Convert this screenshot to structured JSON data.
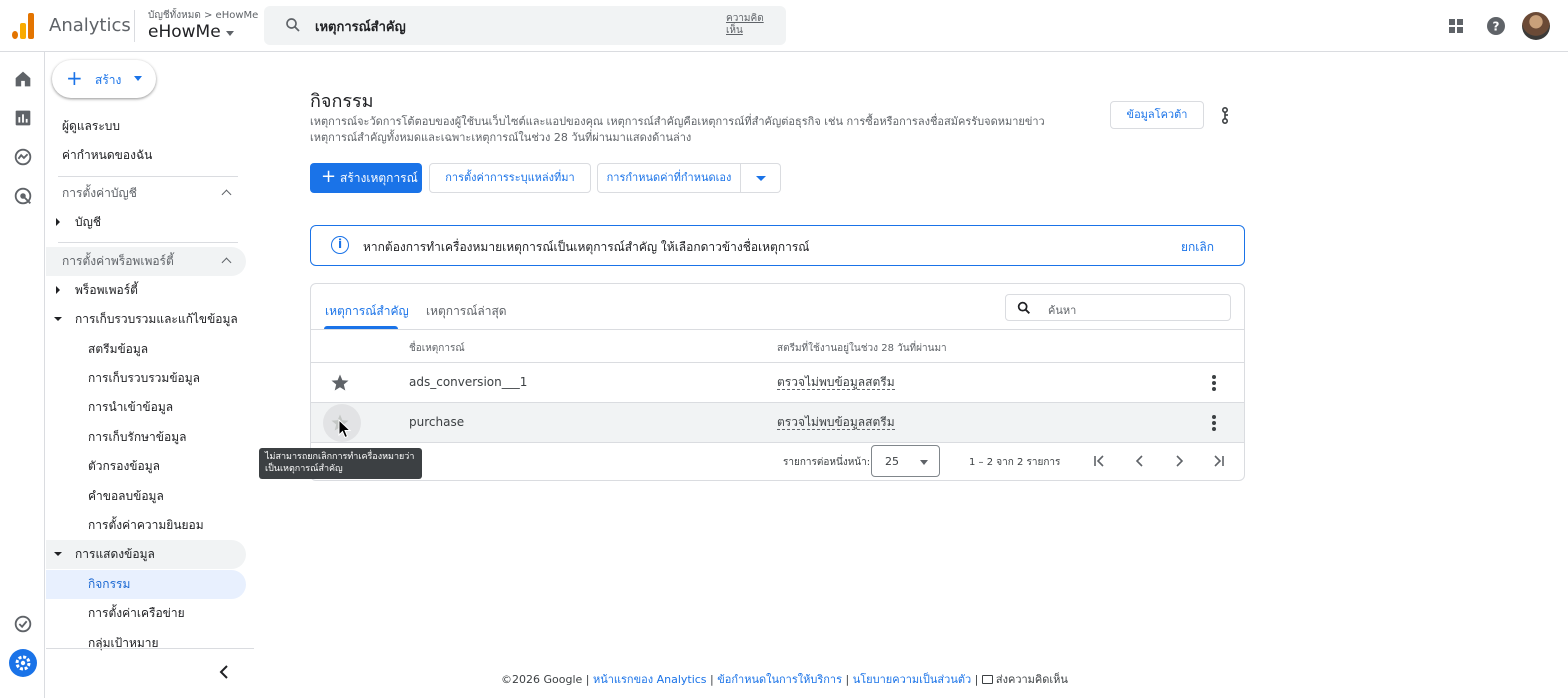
{
  "header": {
    "app_name": "Analytics",
    "account_crumb": "บัญชีทั้งหมด > eHowMe",
    "account_name": "eHowMe",
    "search_text": "เหตุการณ์สำคัญ",
    "feedback": "ความคิดเห็น"
  },
  "sidebar": {
    "create_label": "สร้าง",
    "items": [
      {
        "label": "ผู้ดูแลระบบ"
      },
      {
        "label": "ค่ากำหนดของฉัน"
      },
      {
        "label": "การตั้งค่าบัญชี"
      },
      {
        "label": "บัญชี"
      },
      {
        "label": "การตั้งค่าพร็อพเพอร์ตี้"
      },
      {
        "label": "พร็อพเพอร์ตี้"
      },
      {
        "label": "การเก็บรวบรวมและแก้ไขข้อมูล"
      },
      {
        "label": "สตรีมข้อมูล"
      },
      {
        "label": "การเก็บรวบรวมข้อมูล"
      },
      {
        "label": "การนำเข้าข้อมูล"
      },
      {
        "label": "การเก็บรักษาข้อมูล"
      },
      {
        "label": "ตัวกรองข้อมูล"
      },
      {
        "label": "คำขอลบข้อมูล"
      },
      {
        "label": "การตั้งค่าความยินยอม"
      },
      {
        "label": "การแสดงข้อมูล"
      },
      {
        "label": "กิจกรรม"
      },
      {
        "label": "การตั้งค่าเครือข่าย"
      },
      {
        "label": "กลุ่มเป้าหมาย"
      }
    ]
  },
  "main": {
    "title": "กิจกรรม",
    "description": "เหตุการณ์จะวัดการโต้ตอบของผู้ใช้บนเว็บไซต์และแอปของคุณ เหตุการณ์สำคัญคือเหตุการณ์ที่สำคัญต่อธุรกิจ เช่น การซื้อหรือการลงชื่อสมัครรับจดหมายข่าว เหตุการณ์สำคัญทั้งหมดและเฉพาะเหตุการณ์ในช่วง 28 วันที่ผ่านมาแสดงด้านล่าง",
    "quota_label": "ข้อมูลโควต้า",
    "create_event": "สร้างเหตุการณ์",
    "attribution_settings": "การตั้งค่าการระบุแหล่งที่มา",
    "custom_definitions": "การกำหนดค่าที่กำหนดเอง",
    "banner_text": "หากต้องการทำเครื่องหมายเหตุการณ์เป็นเหตุการณ์สำคัญ ให้เลือกดาวข้างชื่อเหตุการณ์",
    "banner_dismiss": "ยกเลิก",
    "tabs": [
      {
        "label": "เหตุการณ์สำคัญ"
      },
      {
        "label": "เหตุการณ์ล่าสุด"
      }
    ],
    "search_placeholder": "ค้นหา",
    "columns": {
      "event_name": "ชื่อเหตุการณ์",
      "stream": "สตรีมที่ใช้งานอยู่ในช่วง 28 วันที่ผ่านมา"
    },
    "rows": [
      {
        "name": "ads_conversion___1",
        "stream": "ตรวจไม่พบข้อมูลสตรีม"
      },
      {
        "name": "purchase",
        "stream": "ตรวจไม่พบข้อมูลสตรีม"
      }
    ],
    "pager": {
      "rows_per_page_label": "รายการต่อหนึ่งหน้า:",
      "rows_per_page": "25",
      "range": "1 – 2 จาก 2 รายการ"
    },
    "tooltip": "ไม่สามารถยกเลิกการทำเครื่องหมายว่าเป็นเหตุการณ์สำคัญ"
  },
  "footer": {
    "copyright": "©2026 Google |",
    "home": "หน้าแรกของ Analytics",
    "sep1": " | ",
    "terms": "ข้อกำหนดในการให้บริการ",
    "sep2": " | ",
    "privacy": "นโยบายความเป็นส่วนตัว",
    "sep3": " | ",
    "feedback": "ส่งความคิดเห็น"
  },
  "colors": {
    "accent": "#1a73e8",
    "logo_orange": "#e37400",
    "logo_yellow": "#f9ab00"
  }
}
